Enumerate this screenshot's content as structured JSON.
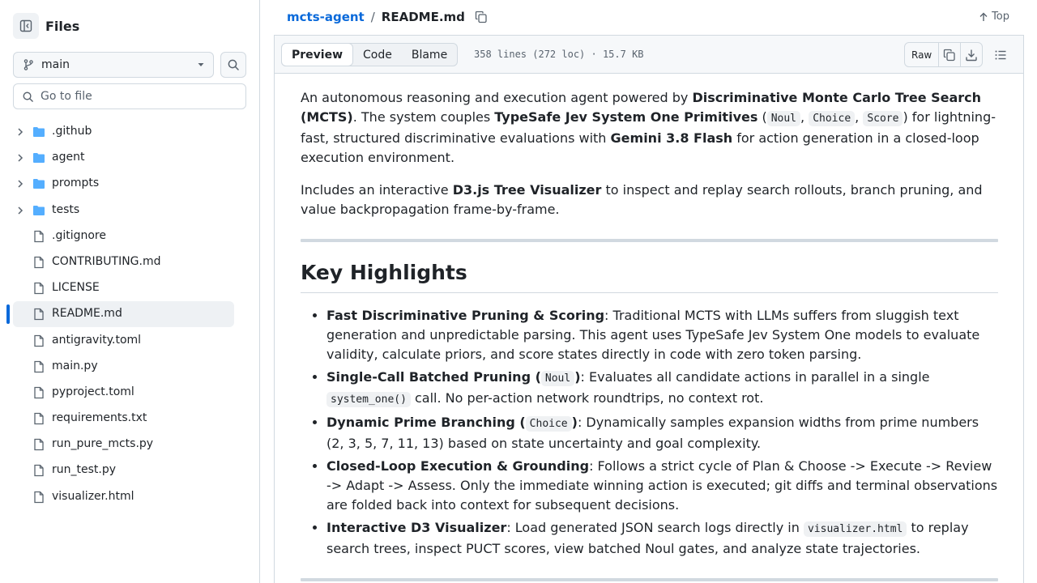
{
  "sidebar": {
    "title": "Files",
    "branch": "main",
    "goto_placeholder": "Go to file",
    "items": [
      {
        "name": ".github",
        "type": "folder"
      },
      {
        "name": "agent",
        "type": "folder"
      },
      {
        "name": "prompts",
        "type": "folder"
      },
      {
        "name": "tests",
        "type": "folder"
      },
      {
        "name": ".gitignore",
        "type": "file"
      },
      {
        "name": "CONTRIBUTING.md",
        "type": "file"
      },
      {
        "name": "LICENSE",
        "type": "file"
      },
      {
        "name": "README.md",
        "type": "file",
        "active": true
      },
      {
        "name": "antigravity.toml",
        "type": "file"
      },
      {
        "name": "main.py",
        "type": "file"
      },
      {
        "name": "pyproject.toml",
        "type": "file"
      },
      {
        "name": "requirements.txt",
        "type": "file"
      },
      {
        "name": "run_pure_mcts.py",
        "type": "file"
      },
      {
        "name": "run_test.py",
        "type": "file"
      },
      {
        "name": "visualizer.html",
        "type": "file"
      }
    ]
  },
  "header": {
    "repo": "mcts-agent",
    "separator": "/",
    "file": "README.md",
    "top_label": "Top"
  },
  "toolbar": {
    "tabs": [
      "Preview",
      "Code",
      "Blame"
    ],
    "selected_tab": "Preview",
    "meta": "358 lines (272 loc) · 15.7 KB",
    "raw_label": "Raw"
  },
  "readme": {
    "intro": {
      "t1": "An autonomous reasoning and execution agent powered by ",
      "b1": "Discriminative Monte Carlo Tree Search (MCTS)",
      "t2": ". The system couples ",
      "b2": "TypeSafe Jev System One Primitives",
      "t3": " (",
      "c1": "Noul",
      "t4": ", ",
      "c2": "Choice",
      "t5": ", ",
      "c3": "Score",
      "t6": ") for lightning-fast, structured discriminative evaluations with ",
      "b3": "Gemini 3.8 Flash",
      "t7": " for action generation in a closed-loop execution environment."
    },
    "viz": {
      "t1": "Includes an interactive ",
      "b1": "D3.js Tree Visualizer",
      "t2": " to inspect and replay search rollouts, branch pruning, and value backpropagation frame-by-frame."
    },
    "heading": "Key Highlights",
    "highlights": {
      "h1": {
        "bold": "Fast Discriminative Pruning & Scoring",
        "text": ": Traditional MCTS with LLMs suffers from sluggish text generation and unpredictable parsing. This agent uses TypeSafe Jev System One models to evaluate validity, calculate priors, and score states directly in code with zero token parsing."
      },
      "h2": {
        "bold_a": "Single-Call Batched Pruning (",
        "code": "Noul",
        "bold_b": ")",
        "text_a": ": Evaluates all candidate actions in parallel in a single ",
        "code2": "system_one()",
        "text_b": " call. No per-action network roundtrips, no context rot."
      },
      "h3": {
        "bold_a": "Dynamic Prime Branching (",
        "code": "Choice",
        "bold_b": ")",
        "text": ": Dynamically samples expansion widths from prime numbers (2, 3, 5, 7, 11, 13) based on state uncertainty and goal complexity."
      },
      "h4": {
        "bold": "Closed-Loop Execution & Grounding",
        "text": ": Follows a strict cycle of Plan & Choose -> Execute -> Review -> Adapt -> Assess. Only the immediate winning action is executed; git diffs and terminal observations are folded back into context for subsequent decisions."
      },
      "h5": {
        "bold": "Interactive D3 Visualizer",
        "text_a": ": Load generated JSON search logs directly in ",
        "code": "visualizer.html",
        "text_b": " to replay search trees, inspect PUCT scores, view batched Noul gates, and analyze state trajectories."
      }
    }
  }
}
